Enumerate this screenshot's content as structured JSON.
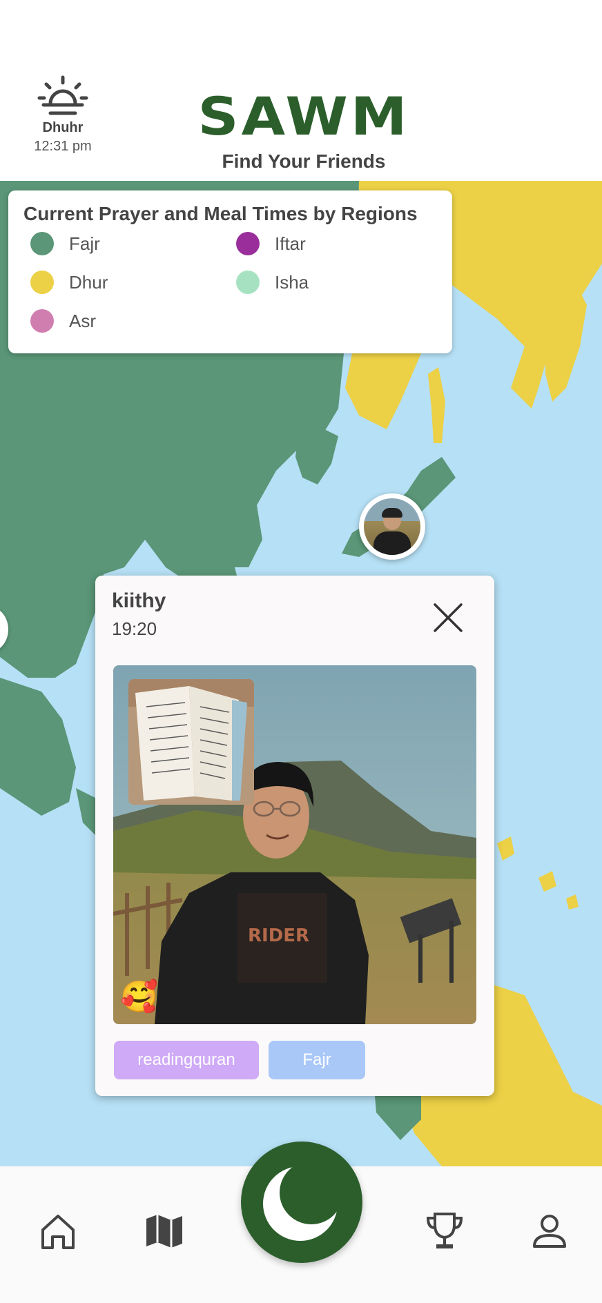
{
  "header": {
    "current_prayer": "Dhuhr",
    "current_time": "12:31 pm",
    "app_title": "SAWM",
    "subtitle": "Find Your Friends"
  },
  "legend": {
    "title": "Current Prayer and Meal Times by Regions",
    "items": [
      {
        "label": "Fajr",
        "color": "#5a9677"
      },
      {
        "label": "Iftar",
        "color": "#9a2f9c"
      },
      {
        "label": "Dhur",
        "color": "#ecd045"
      },
      {
        "label": "Isha",
        "color": "#a6e2c2"
      },
      {
        "label": "Asr",
        "color": "#d07eb0"
      }
    ]
  },
  "map": {
    "ocean_color": "#b6e0f5",
    "fajr_color": "#5a9677",
    "dhur_color": "#ecd045"
  },
  "popup": {
    "username": "kiithy",
    "time": "19:20",
    "emoji": "🥰",
    "tags": {
      "activity": "readingquran",
      "prayer": "Fajr"
    }
  },
  "nav": {
    "items": [
      "home-icon",
      "map-icon",
      "crescent-icon",
      "trophy-icon",
      "profile-icon"
    ],
    "accent": "#2b5e2b"
  }
}
